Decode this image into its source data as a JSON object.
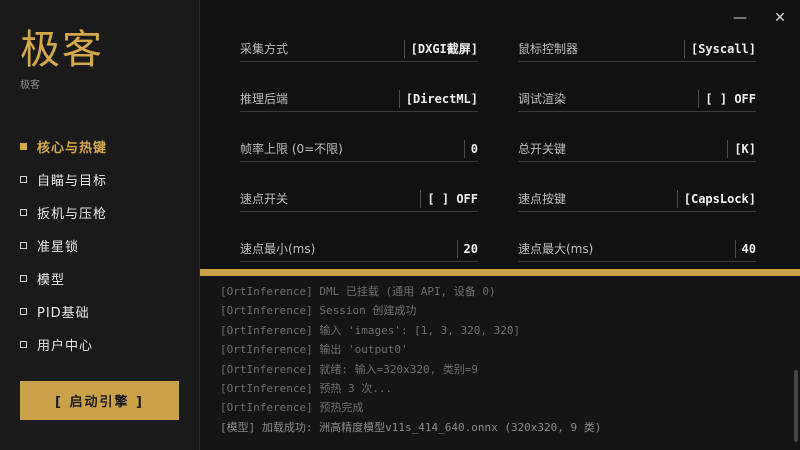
{
  "app": {
    "title": "极客",
    "subtitle": "极客"
  },
  "window_controls": {
    "minimize": "—",
    "close": "✕"
  },
  "sidebar": {
    "items": [
      {
        "label": "核心与热键",
        "active": true
      },
      {
        "label": "自瞄与目标",
        "active": false
      },
      {
        "label": "扳机与压枪",
        "active": false
      },
      {
        "label": "准星锁",
        "active": false
      },
      {
        "label": "模型",
        "active": false
      },
      {
        "label": "PID基础",
        "active": false
      },
      {
        "label": "用户中心",
        "active": false
      }
    ],
    "start_button": "[ 启动引擎 ]"
  },
  "settings": [
    {
      "label": "采集方式",
      "value": "[DXGI截屏]"
    },
    {
      "label": "鼠标控制器",
      "value": "[Syscall]"
    },
    {
      "label": "推理后端",
      "value": "[DirectML]"
    },
    {
      "label": "调试渲染",
      "value": "[ ] OFF"
    },
    {
      "label": "帧率上限 (0=不限)",
      "value": "0"
    },
    {
      "label": "总开关键",
      "value": "[K]"
    },
    {
      "label": "速点开关",
      "value": "[ ] OFF"
    },
    {
      "label": "速点按键",
      "value": "[CapsLock]"
    },
    {
      "label": "速点最小(ms)",
      "value": "20"
    },
    {
      "label": "速点最大(ms)",
      "value": "40"
    }
  ],
  "log": [
    "[OrtInference] DML 已挂载 (通用 API, 设备 0)",
    "[OrtInference] Session 创建成功",
    "[OrtInference] 输入 'images': [1, 3, 320, 320]",
    "[OrtInference] 输出 'output0'",
    "[OrtInference] 就绪: 输入=320x320, 类别=9",
    "[OrtInference] 预热 3 次...",
    "[OrtInference] 预热完成",
    "[模型] 加载成功: 洲高精度模型v11s_414_640.onnx (320x320, 9 类)"
  ],
  "colors": {
    "accent": "#c9a24a",
    "background": "#111111",
    "sidebar": "#1a1a1a"
  }
}
